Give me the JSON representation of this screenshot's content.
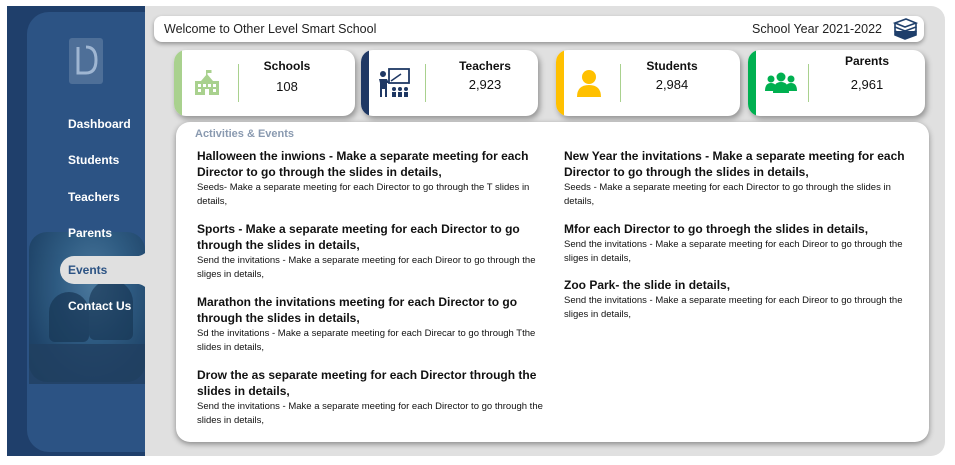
{
  "header": {
    "welcome": "Welcome to Other Level Smart School",
    "school_year": "School Year 2021-2022",
    "icon": "books-stack-icon"
  },
  "sidebar": {
    "logo": "OL",
    "items": [
      {
        "label": "Dashboard",
        "active": false
      },
      {
        "label": "Students",
        "active": false
      },
      {
        "label": "Teachers",
        "active": false
      },
      {
        "label": "Parents",
        "active": false
      },
      {
        "label": "Events",
        "active": true
      },
      {
        "label": "Contact Us",
        "active": false
      }
    ]
  },
  "stats": [
    {
      "label": "Schools",
      "value": "108",
      "icon": "school-building-icon",
      "color": "#a9d18e"
    },
    {
      "label": "Teachers",
      "value": "2,923",
      "icon": "teacher-board-icon",
      "color": "#1f3864"
    },
    {
      "label": "Students",
      "value": "2,984",
      "icon": "student-person-icon",
      "color": "#ffc000"
    },
    {
      "label": "Parents",
      "value": "2,961",
      "icon": "parents-group-icon",
      "color": "#00b050"
    }
  ],
  "events_panel": {
    "title": "Activities & Events",
    "events": [
      {
        "title": "Halloween the inwions - Make a separate meeting for each Director to go through the slides in details,",
        "desc": "Seeds- Make a separate meeting for each Director to go through the T slides in details,"
      },
      {
        "title": "Sports - Make a separate meeting for each Director to go through the slides in details,",
        "desc": "Send the invitations - Make a separate meeting for each Direor to go through the sliges in details,"
      },
      {
        "title": "Marathon the invitations meeting for each Director to go through the slides in details,",
        "desc": "Sd the invitations - Make a separate meeting for each Direcar to go through Tthe slides in details,"
      },
      {
        "title": "Drow the as separate meeting for each Director through the slides in details,",
        "desc": "Send the invitations - Make a separate meeting for each Director to go through the slides in details,"
      },
      {
        "title": "New Year the invitations - Make a separate meeting for each Director to go through the slides in details,",
        "desc": "Seeds - Make a separate meeting for each Director to go through the slides in details,"
      },
      {
        "title": "Mfor each Director to go throegh the slides in details,",
        "desc": "Send the invitations - Make a separate meeting for each Direor to go through the sliges in details,"
      },
      {
        "title": "Zoo Park- the slide in details,",
        "desc": "Send the invitations - Make a separate meeting for each Direor to go through the sliges in details,"
      }
    ]
  },
  "colors": {
    "navy": "#1f3f6b",
    "sidebar": "#2c5384",
    "active_text": "#2c5384",
    "background": "#e0e0e0"
  }
}
